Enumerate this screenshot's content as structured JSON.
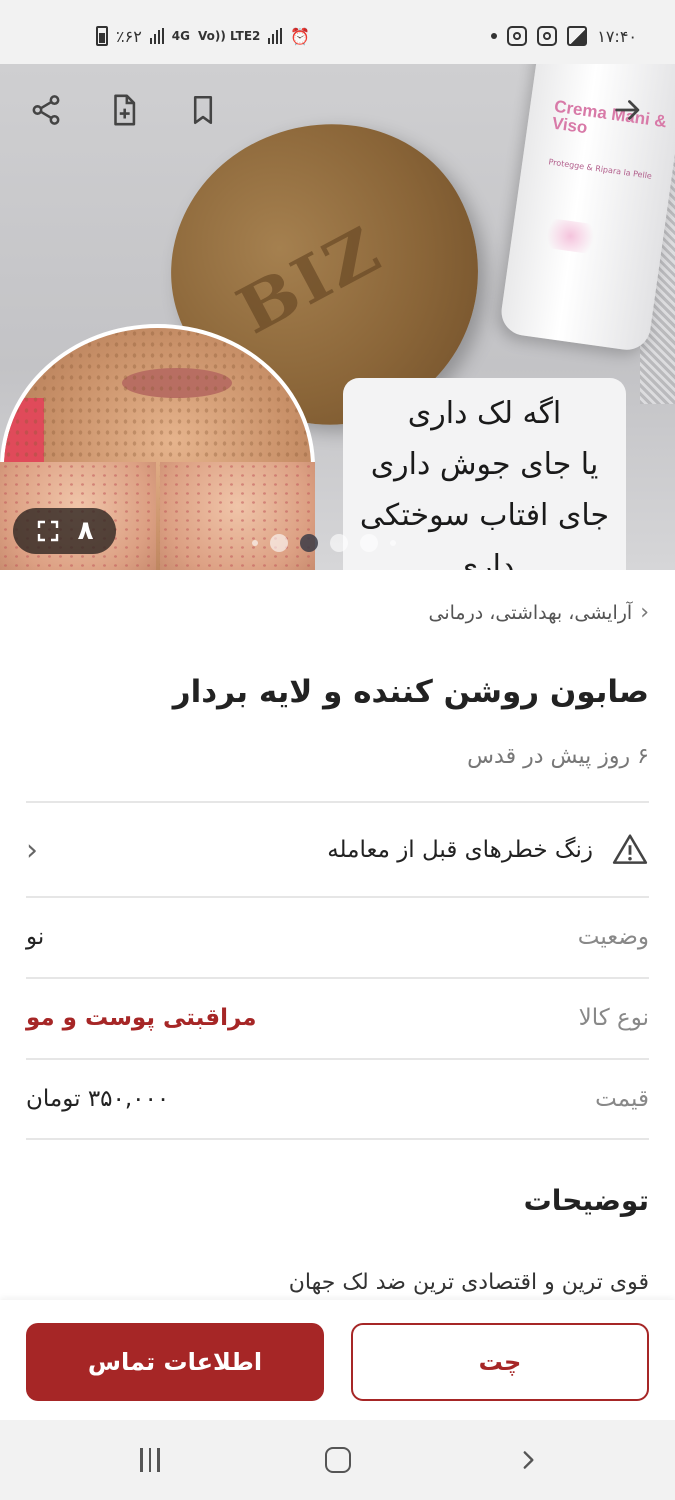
{
  "status_bar": {
    "time": "۱۷:۴۰",
    "battery": "٪۶۲",
    "net_4g": "4G",
    "volte": "Vo)) LTE2",
    "icons": [
      "instagram-icon",
      "instagram-icon",
      "gallery-icon",
      "notification-dot"
    ],
    "alarm_icon": "alarm-icon"
  },
  "hero": {
    "image_counter": "۸",
    "promo_text": [
      "اگه لک داری",
      "یا جای جوش داری",
      "جای افتاب سوختکی",
      "داری"
    ],
    "soap_text": "BIZ",
    "tube_label": "Crema Mani & Viso",
    "tube_sub": "Protegge & Ripara la Pelle",
    "active_dot": 2,
    "dot_count": 6
  },
  "header_actions": {
    "share_icon": "share-icon",
    "note_icon": "add-note-icon",
    "bookmark_icon": "bookmark-icon",
    "back_icon": "arrow-right-icon"
  },
  "listing": {
    "breadcrumb": "آرایشی، بهداشتی، درمانی",
    "title": "صابون روشن کننده و لایه بردار",
    "meta": "۶ روز پیش در قدس",
    "warning": "زنگ خطرهای قبل از معامله",
    "fields": [
      {
        "key": "وضعیت",
        "value": "نو"
      },
      {
        "key": "نوع کالا",
        "value": "مراقبتی پوست و مو"
      },
      {
        "key": "قیمت",
        "value": "۳۵۰,۰۰۰ تومان"
      }
    ],
    "description_title": "توضیحات",
    "description": "قوی ترین و اقتصادی ترین ضد لک جهان"
  },
  "actions": {
    "chat": "چت",
    "contact": "اطلاعات تماس"
  },
  "colors": {
    "accent": "#a62626",
    "status_bar_bg": "#f2f2f2"
  }
}
